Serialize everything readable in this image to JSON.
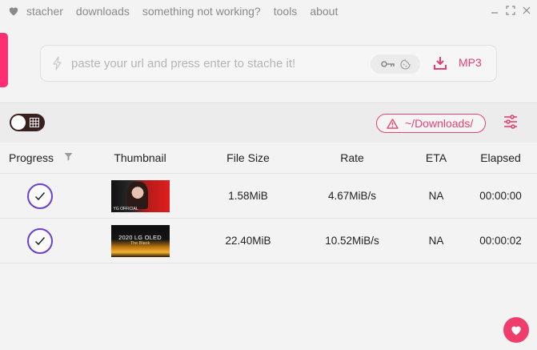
{
  "menu": {
    "items": [
      "stacher",
      "downloads",
      "something not working?",
      "tools",
      "about"
    ]
  },
  "urlbar": {
    "placeholder": "paste your url and press enter to stache it!",
    "format_label": "MP3"
  },
  "toolbar": {
    "download_path": "~/Downloads/"
  },
  "table": {
    "headers": {
      "progress": "Progress",
      "thumbnail": "Thumbnail",
      "file_size": "File Size",
      "rate": "Rate",
      "eta": "ETA",
      "elapsed": "Elapsed"
    },
    "rows": [
      {
        "status": "complete",
        "file_size": "1.58MiB",
        "rate": "4.67MiB/s",
        "eta": "NA",
        "elapsed": "00:00:00",
        "thumb_label": "YG OFFICIAL"
      },
      {
        "status": "complete",
        "file_size": "22.40MiB",
        "rate": "10.52MiB/s",
        "eta": "NA",
        "elapsed": "00:00:02",
        "thumb_title": "2020 LG OLED",
        "thumb_subtitle": "The Black"
      }
    ]
  },
  "colors": {
    "accent": "#ff2d72",
    "check": "#6a3fd6",
    "toggle": "#3a1f1f"
  },
  "icons": [
    "heart-icon",
    "minimize-icon",
    "maximize-icon",
    "close-icon",
    "bolt-icon",
    "key-icon",
    "cookie-icon",
    "download-icon",
    "grid-icon",
    "warning-icon",
    "sliders-icon",
    "filter-icon",
    "check-icon"
  ]
}
